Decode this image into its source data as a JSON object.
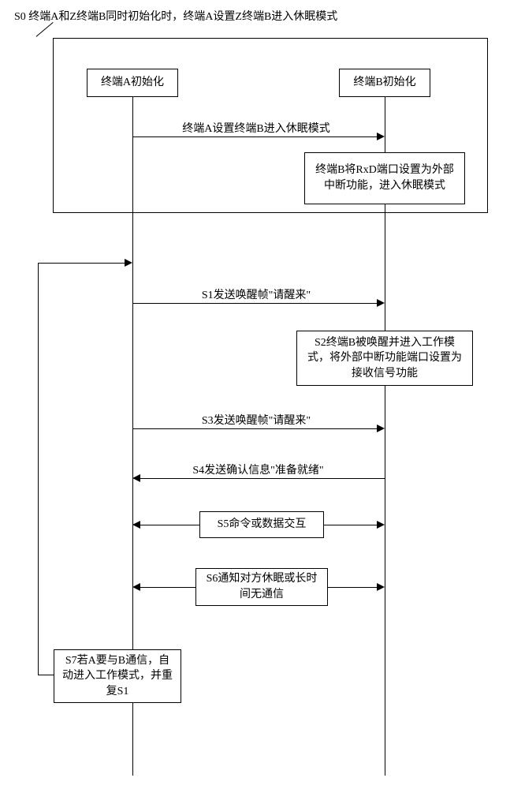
{
  "s0": {
    "header": "S0  终端A和Z终端B同时初始化时，终端A设置Z终端B进入休眠模式",
    "terminalA_init": "终端A初始化",
    "terminalB_init": "终端B初始化",
    "msg_set_sleep": "终端A设置终端B进入休眠模式",
    "terminalB_sleep_action": "终端B将RxD端口设置为外部中断功能，进入休眠模式"
  },
  "steps": {
    "s1": "S1发送唤醒帧\"请醒来\"",
    "s2": "S2终端B被唤醒并进入工作模式，将外部中断功能端口设置为接收信号功能",
    "s3": "S3发送唤醒帧\"请醒来\"",
    "s4": "S4发送确认信息\"准备就绪\"",
    "s5": "S5命令或数据交互",
    "s6": "S6通知对方休眠或长时间无通信",
    "s7": "S7若A要与B通信，自动进入工作模式，并重复S1"
  }
}
